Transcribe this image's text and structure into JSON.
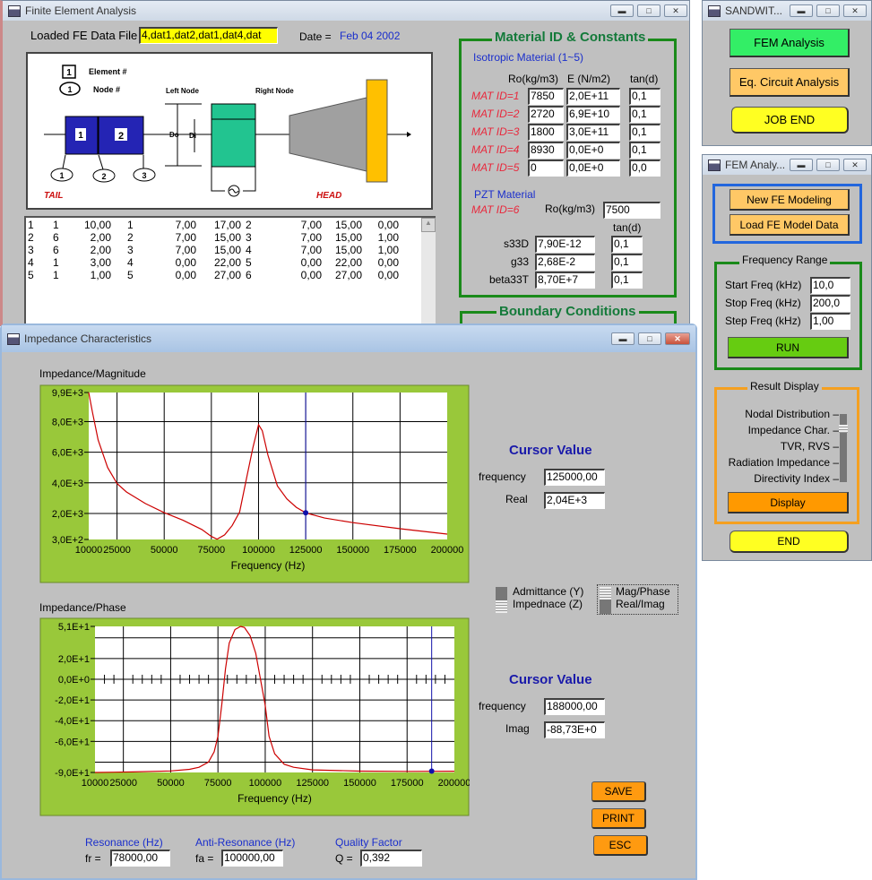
{
  "fea_window": {
    "title": "Finite Element Analysis",
    "loaded_label": "Loaded FE Data File",
    "loaded_value": "4,dat1,dat2,dat1,dat4,dat",
    "date_label": "Date =",
    "date_value": "Feb 04 2002",
    "diagram": {
      "element_legend": "Element #",
      "node_legend": "Node #",
      "legend_element_num": "1",
      "legend_node_num": "1",
      "left_node": "Left Node",
      "right_node": "Right Node",
      "do_label": "Do",
      "di_label": "Di",
      "elements": [
        "1",
        "2"
      ],
      "nodes": [
        "1",
        "2",
        "3"
      ],
      "tail": "TAIL",
      "head": "HEAD"
    },
    "table_rows": [
      [
        "1",
        "1",
        "10,00",
        "1",
        "7,00",
        "17,00",
        "2",
        "7,00",
        "15,00",
        "0,00"
      ],
      [
        "2",
        "6",
        "2,00",
        "2",
        "7,00",
        "15,00",
        "3",
        "7,00",
        "15,00",
        "1,00"
      ],
      [
        "3",
        "6",
        "2,00",
        "3",
        "7,00",
        "15,00",
        "4",
        "7,00",
        "15,00",
        "1,00"
      ],
      [
        "4",
        "1",
        "3,00",
        "4",
        "0,00",
        "22,00",
        "5",
        "0,00",
        "22,00",
        "0,00"
      ],
      [
        "5",
        "1",
        "1,00",
        "5",
        "0,00",
        "27,00",
        "6",
        "0,00",
        "27,00",
        "0,00"
      ]
    ],
    "materials": {
      "title": "Material ID & Constants",
      "iso_title": "Isotropic Material (1~5)",
      "headers": [
        "Ro(kg/m3)",
        "E (N/m2)",
        "tan(d)"
      ],
      "rows": [
        {
          "id": "MAT ID=1",
          "ro": "7850",
          "e": "2,0E+11",
          "tan": "0,1"
        },
        {
          "id": "MAT ID=2",
          "ro": "2720",
          "e": "6,9E+10",
          "tan": "0,1"
        },
        {
          "id": "MAT ID=3",
          "ro": "1800",
          "e": "3,0E+11",
          "tan": "0,1"
        },
        {
          "id": "MAT ID=4",
          "ro": "8930",
          "e": "0,0E+0",
          "tan": "0,1"
        },
        {
          "id": "MAT ID=5",
          "ro": "0",
          "e": "0,0E+0",
          "tan": "0,0"
        }
      ],
      "pzt_title": "PZT Material",
      "pzt_id": "MAT ID=6",
      "pzt_ro_label": "Ro(kg/m3)",
      "pzt_ro": "7500",
      "pzt_tan_header": "tan(d)",
      "pzt_rows": [
        {
          "label": "s33D",
          "value": "7,90E-12",
          "tan": "0,1"
        },
        {
          "label": "g33",
          "value": "2,68E-2",
          "tan": "0,1"
        },
        {
          "label": "beta33T",
          "value": "8,70E+7",
          "tan": "0,1"
        }
      ]
    },
    "boundary_title": "Boundary Conditions"
  },
  "sandwich_window": {
    "title": "SANDWIT...",
    "fem_analysis": "FEM Analysis",
    "eq_circuit": "Eq. Circuit Analysis",
    "job_end": "JOB END"
  },
  "fem_window": {
    "title": "FEM Analy...",
    "new_model": "New FE Modeling",
    "load_model": "Load FE Model Data",
    "freq_range_title": "Frequency Range",
    "start_label": "Start Freq (kHz)",
    "start_value": "10,0",
    "stop_label": "Stop Freq (kHz)",
    "stop_value": "200,0",
    "step_label": "Step Freq (kHz)",
    "step_value": "1,00",
    "run": "RUN",
    "result_title": "Result Display",
    "result_items": [
      "Nodal Distribution",
      "Impedance Char.",
      "TVR, RVS",
      "Radiation Impedance",
      "Directivity Index"
    ],
    "result_selected": "Impedance Char.",
    "display": "Display",
    "end": "END"
  },
  "impedance_window": {
    "title": "Impedance Characteristics",
    "cursor1": {
      "title": "Cursor Value",
      "freq_label": "frequency",
      "freq_value": "125000,00",
      "val_label": "Real",
      "val_value": "2,04E+3"
    },
    "cursor2": {
      "title": "Cursor Value",
      "freq_label": "frequency",
      "freq_value": "188000,00",
      "val_label": "Imag",
      "val_value": "-88,73E+0"
    },
    "toggle_yz": {
      "options": [
        "Admittance (Y)",
        "Impednace (Z)"
      ],
      "selected": "Impednace (Z)"
    },
    "toggle_mode": {
      "options": [
        "Mag/Phase",
        "Real/Imag"
      ],
      "selected": "Mag/Phase"
    },
    "save": "SAVE",
    "print": "PRINT",
    "esc": "ESC",
    "resonance_title": "Resonance (Hz)",
    "fr_label": "fr =",
    "fr_value": "78000,00",
    "anti_title": "Anti-Resonance (Hz)",
    "fa_label": "fa =",
    "fa_value": "100000,00",
    "q_title": "Quality Factor",
    "q_label": "Q =",
    "q_value": "0,392"
  },
  "colors": {
    "plot_panel": "#99c83a",
    "curve": "#cc0000",
    "cursor": "#1010aa"
  },
  "chart_data": [
    {
      "type": "line",
      "title": "Impedance/Magnitude",
      "xlabel": "Frequency (Hz)",
      "ylabel": "",
      "xlim": [
        10000,
        200000
      ],
      "ylim": [
        300,
        9900
      ],
      "xticks": [
        10000,
        25000,
        50000,
        75000,
        100000,
        125000,
        150000,
        175000,
        200000
      ],
      "xtick_labels": [
        "10000",
        "25000",
        "50000",
        "75000",
        "100000",
        "125000",
        "150000",
        "175000",
        "200000"
      ],
      "yticks": [
        9900,
        8000,
        6000,
        4000,
        2000,
        300
      ],
      "ytick_labels": [
        "9,9E+3",
        "8,0E+3",
        "6,0E+3",
        "4,0E+3",
        "2,0E+3",
        "3,0E+2"
      ],
      "ygrid": [
        8000,
        6000,
        4000,
        2000
      ],
      "grid": true,
      "cursor": {
        "x": 125000,
        "y": 2040
      },
      "x": [
        10000,
        12000,
        15000,
        20000,
        25000,
        30000,
        40000,
        50000,
        60000,
        70000,
        75000,
        78000,
        82000,
        86000,
        90000,
        94000,
        97000,
        100000,
        102000,
        105000,
        110000,
        115000,
        120000,
        125000,
        135000,
        150000,
        175000,
        200000
      ],
      "y": [
        9900,
        8600,
        6800,
        5000,
        3950,
        3400,
        2650,
        2050,
        1550,
        950,
        500,
        320,
        600,
        1200,
        2100,
        4500,
        6300,
        7800,
        7400,
        5800,
        3800,
        2950,
        2400,
        2040,
        1700,
        1400,
        1000,
        650
      ]
    },
    {
      "type": "line",
      "title": "Impedance/Phase",
      "xlabel": "Frequency (Hz)",
      "ylabel": "",
      "xlim": [
        10000,
        200000
      ],
      "ylim": [
        -90,
        51
      ],
      "xticks": [
        10000,
        25000,
        50000,
        75000,
        100000,
        125000,
        150000,
        175000,
        200000
      ],
      "xtick_labels": [
        "10000",
        "25000",
        "50000",
        "75000",
        "100000",
        "125000",
        "150000",
        "175000",
        "200000"
      ],
      "yticks": [
        51,
        20,
        0,
        -20,
        -40,
        -60,
        -90
      ],
      "ytick_labels": [
        "5,1E+1",
        "2,0E+1",
        "0,0E+0",
        "-2,0E+1",
        "-4,0E+1",
        "-6,0E+1",
        "-9,0E+1"
      ],
      "ygrid": [
        40,
        20,
        0,
        -20,
        -40,
        -60,
        -80
      ],
      "grid": true,
      "cursor": {
        "x": 188000,
        "y": -88.73
      },
      "x": [
        10000,
        30000,
        50000,
        60000,
        65000,
        70000,
        73000,
        75000,
        77000,
        79000,
        81000,
        84000,
        87000,
        89000,
        92000,
        95000,
        97000,
        99000,
        100000,
        102000,
        105000,
        110000,
        115000,
        125000,
        150000,
        175000,
        200000
      ],
      "y": [
        -90,
        -89.5,
        -88.5,
        -87,
        -85,
        -80,
        -70,
        -55,
        -25,
        10,
        35,
        48,
        51,
        50,
        42,
        25,
        5,
        -15,
        -25,
        -55,
        -72,
        -82,
        -85,
        -87.5,
        -88.7,
        -89,
        -88.8
      ]
    }
  ]
}
